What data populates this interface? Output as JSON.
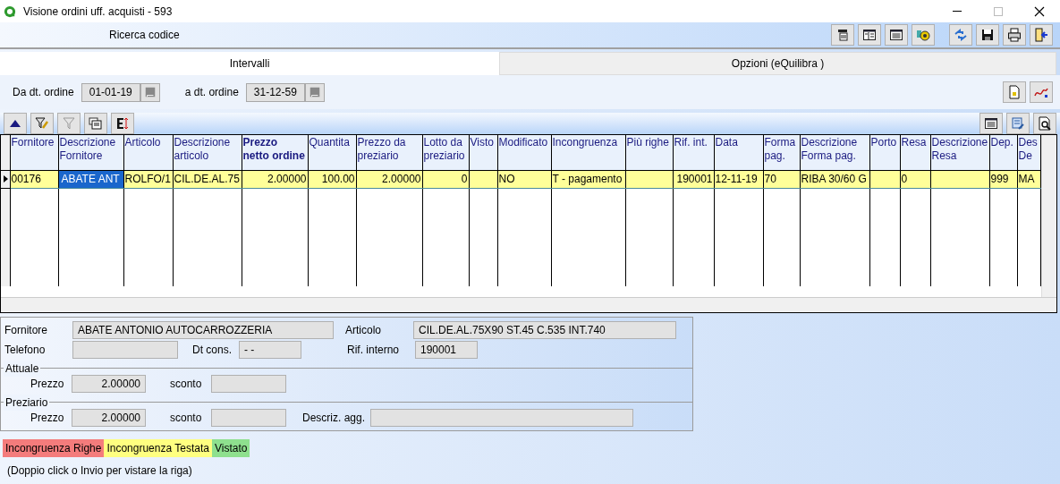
{
  "window": {
    "title": "Visione ordini uff. acquisti - 593"
  },
  "toolbar": {
    "search_label": "Ricerca codice"
  },
  "tabs": [
    {
      "label": "Intervalli",
      "selected": true
    },
    {
      "label": "Opzioni (eQuilibra )",
      "selected": false
    }
  ],
  "filters": [
    {
      "label": "Da dt. ordine",
      "value": "01-01-19"
    },
    {
      "label": "a dt. ordine",
      "value": "31-12-59"
    }
  ],
  "table": {
    "columns": [
      {
        "label": "Fornitore",
        "bold": false,
        "kind": "text"
      },
      {
        "label": "Descrizione Fornitore",
        "bold": false,
        "kind": "text"
      },
      {
        "label": "Articolo",
        "bold": false,
        "kind": "text"
      },
      {
        "label": "Descrizione articolo",
        "bold": false,
        "kind": "text"
      },
      {
        "label": "Prezzo netto ordine",
        "bold": true,
        "kind": "number"
      },
      {
        "label": "Quantita",
        "bold": false,
        "kind": "number"
      },
      {
        "label": "Prezzo da preziario",
        "bold": false,
        "kind": "number"
      },
      {
        "label": "Lotto da preziario",
        "bold": false,
        "kind": "number"
      },
      {
        "label": "Visto",
        "bold": false,
        "kind": "text"
      },
      {
        "label": "Modificato",
        "bold": false,
        "kind": "text"
      },
      {
        "label": "Incongruenza",
        "bold": false,
        "kind": "text"
      },
      {
        "label": "Più righe",
        "bold": false,
        "kind": "text"
      },
      {
        "label": "Rif. int.",
        "bold": false,
        "kind": "number"
      },
      {
        "label": "Data",
        "bold": false,
        "kind": "text"
      },
      {
        "label": "Forma pag.",
        "bold": false,
        "kind": "text"
      },
      {
        "label": "Descrizione Forma pag.",
        "bold": false,
        "kind": "text"
      },
      {
        "label": "Porto",
        "bold": false,
        "kind": "text"
      },
      {
        "label": "Resa",
        "bold": false,
        "kind": "text"
      },
      {
        "label": "Descrizione Resa",
        "bold": false,
        "kind": "text"
      },
      {
        "label": "Dep.",
        "bold": false,
        "kind": "text"
      },
      {
        "label": "Des De",
        "bold": false,
        "kind": "text"
      }
    ],
    "rows": [
      {
        "selected": true,
        "color": "#ffff99",
        "cells": [
          {
            "text": "00176",
            "selected": false
          },
          {
            "text": "ABATE ANT",
            "selected": true
          },
          {
            "text": "ROLFO/1",
            "selected": false
          },
          {
            "text": "CIL.DE.AL.75",
            "selected": false
          },
          {
            "text": "2.00000",
            "selected": false
          },
          {
            "text": "100.00",
            "selected": false
          },
          {
            "text": "2.00000",
            "selected": false
          },
          {
            "text": "0",
            "selected": false
          },
          {
            "text": "",
            "selected": false
          },
          {
            "text": "NO",
            "selected": false
          },
          {
            "text": "T - pagamento",
            "selected": false
          },
          {
            "text": "",
            "selected": false
          },
          {
            "text": "190001",
            "selected": false
          },
          {
            "text": "12-11-19",
            "selected": false
          },
          {
            "text": "70",
            "selected": false
          },
          {
            "text": "RIBA 30/60 G",
            "selected": false
          },
          {
            "text": "",
            "selected": false
          },
          {
            "text": "0",
            "selected": false
          },
          {
            "text": "",
            "selected": false
          },
          {
            "text": "999",
            "selected": false
          },
          {
            "text": "MA",
            "selected": false
          }
        ]
      }
    ]
  },
  "details": {
    "fornitore": {
      "label": "Fornitore",
      "value": "ABATE ANTONIO AUTOCARROZZERIA"
    },
    "articolo": {
      "label": "Articolo",
      "value": "CIL.DE.AL.75X90 ST.45 C.535 INT.740"
    },
    "telefono": {
      "label": "Telefono"
    },
    "dt_cons": {
      "label": "Dt cons.",
      "value": "- -"
    },
    "rif_interno": {
      "label": "Rif. interno",
      "value": "190001"
    },
    "sections": [
      {
        "title": "Attuale",
        "prezzo_label": "Prezzo",
        "prezzo": "2.00000",
        "sconto_label": "sconto"
      },
      {
        "title": "Preziario",
        "prezzo_label": "Prezzo",
        "prezzo": "2.00000",
        "sconto_label": "sconto",
        "extra_label": "Descriz. agg."
      }
    ]
  },
  "legend": [
    {
      "label": "Incongruenza Righe",
      "color": "#f47c7c"
    },
    {
      "label": "Incongruenza Testata",
      "color": "#ffff80"
    },
    {
      "label": "Vistato",
      "color": "#8ee08e"
    }
  ],
  "hint": "(Doppio click o Invio per vistare la riga)"
}
